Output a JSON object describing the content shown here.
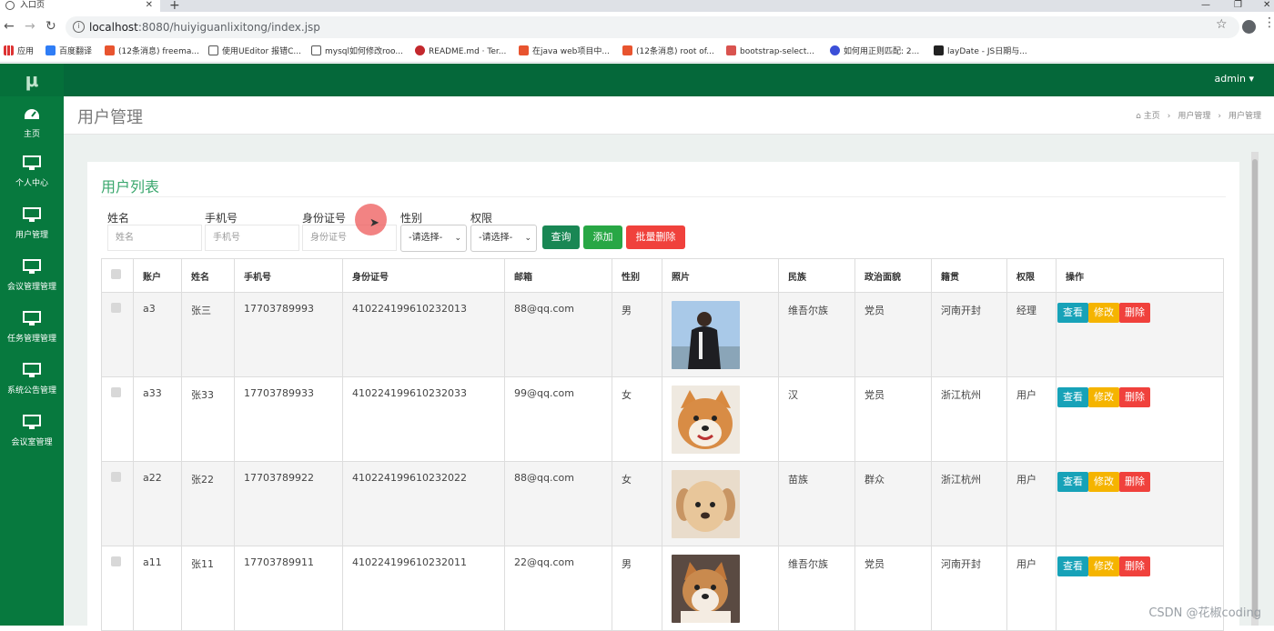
{
  "browser": {
    "tab_title": "入口页",
    "url_host": "localhost",
    "url_path": ":8080/huiyiguanlixitong/index.jsp",
    "bookmarks": [
      "应用",
      "百度翻译",
      "(12条消息) freema...",
      "使用UEditor 报错C...",
      "mysql如何修改roo...",
      "README.md · Ter...",
      "在java web项目中...",
      "(12条消息) root of...",
      "bootstrap-select...",
      "如何用正则匹配: 2...",
      "layDate - JS日期与..."
    ]
  },
  "app": {
    "logo": "μ",
    "user": "admin ▾"
  },
  "sidebar": {
    "items": [
      {
        "label": "主页",
        "icon": "dashboard-icon"
      },
      {
        "label": "个人中心",
        "icon": "monitor-icon"
      },
      {
        "label": "用户管理",
        "icon": "monitor-icon"
      },
      {
        "label": "会议管理管理",
        "icon": "monitor-icon"
      },
      {
        "label": "任务管理管理",
        "icon": "monitor-icon"
      },
      {
        "label": "系统公告管理",
        "icon": "monitor-icon"
      },
      {
        "label": "会议室管理",
        "icon": "monitor-icon"
      }
    ]
  },
  "header": {
    "title": "用户管理",
    "breadcrumb": [
      "主页",
      "用户管理",
      "用户管理"
    ]
  },
  "card": {
    "title": "用户列表"
  },
  "filters": {
    "name_label": "姓名",
    "name_placeholder": "姓名",
    "phone_label": "手机号",
    "phone_placeholder": "手机号",
    "id_label": "身份证号",
    "id_placeholder": "身份证号",
    "gender_label": "性别",
    "gender_selected": "-请选择-",
    "role_label": "权限",
    "role_selected": "-请选择-",
    "search_btn": "查询",
    "add_btn": "添加",
    "batch_delete_btn": "批量删除"
  },
  "table": {
    "headers": [
      "账户",
      "姓名",
      "手机号",
      "身份证号",
      "邮箱",
      "性别",
      "照片",
      "民族",
      "政治面貌",
      "籍贯",
      "权限",
      "操作"
    ],
    "actions": {
      "view": "查看",
      "edit": "修改",
      "delete": "删除"
    },
    "rows": [
      {
        "account": "a3",
        "name": "张三",
        "phone": "17703789993",
        "idcard": "410224199610232013",
        "email": "88@qq.com",
        "gender": "男",
        "photo": "person-photo",
        "ethnicity": "维吾尔族",
        "political": "党员",
        "hometown": "河南开封",
        "role": "经理"
      },
      {
        "account": "a33",
        "name": "张33",
        "phone": "17703789933",
        "idcard": "410224199610232033",
        "email": "99@qq.com",
        "gender": "女",
        "photo": "shiba-photo",
        "ethnicity": "汉",
        "political": "党员",
        "hometown": "浙江杭州",
        "role": "用户"
      },
      {
        "account": "a22",
        "name": "张22",
        "phone": "17703789922",
        "idcard": "410224199610232022",
        "email": "88@qq.com",
        "gender": "女",
        "photo": "puppy-photo",
        "ethnicity": "苗族",
        "political": "群众",
        "hometown": "浙江杭州",
        "role": "用户"
      },
      {
        "account": "a11",
        "name": "张11",
        "phone": "17703789911",
        "idcard": "410224199610232011",
        "email": "22@qq.com",
        "gender": "男",
        "photo": "shiba-puppy-photo",
        "ethnicity": "维吾尔族",
        "political": "党员",
        "hometown": "河南开封",
        "role": "用户"
      }
    ]
  },
  "watermark": "CSDN @花椒coding",
  "colors": {
    "sidebar": "#07793e",
    "topbar": "#05683a",
    "view": "#17a2b8",
    "edit": "#f5b400",
    "delete": "#f0413c",
    "search": "#198754",
    "add": "#28a745"
  }
}
